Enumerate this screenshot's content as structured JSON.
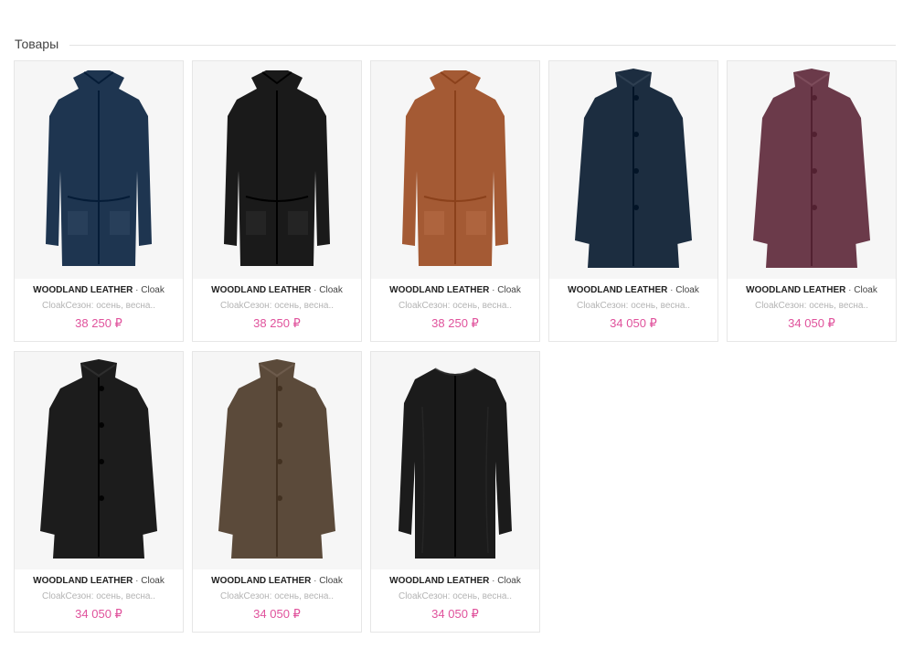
{
  "section": {
    "title": "Товары"
  },
  "products": [
    {
      "brand": "WOODLAND LEATHER",
      "separator": " · ",
      "category": "Cloak",
      "description": "CloakСезон: осень, весна..",
      "price": "38 250 ₽",
      "color": "#1e3550",
      "style": "parka"
    },
    {
      "brand": "WOODLAND LEATHER",
      "separator": " · ",
      "category": "Cloak",
      "description": "CloakСезон: осень, весна..",
      "price": "38 250 ₽",
      "color": "#1a1a1a",
      "style": "parka"
    },
    {
      "brand": "WOODLAND LEATHER",
      "separator": " · ",
      "category": "Cloak",
      "description": "CloakСезон: осень, весна..",
      "price": "38 250 ₽",
      "color": "#a45a34",
      "style": "parka"
    },
    {
      "brand": "WOODLAND LEATHER",
      "separator": " · ",
      "category": "Cloak",
      "description": "CloakСезон: осень, весна..",
      "price": "34 050 ₽",
      "color": "#1c2d40",
      "style": "aline"
    },
    {
      "brand": "WOODLAND LEATHER",
      "separator": " · ",
      "category": "Cloak",
      "description": "CloakСезон: осень, весна..",
      "price": "34 050 ₽",
      "color": "#6b3a4a",
      "style": "aline"
    },
    {
      "brand": "WOODLAND LEATHER",
      "separator": " · ",
      "category": "Cloak",
      "description": "CloakСезон: осень, весна..",
      "price": "34 050 ₽",
      "color": "#1c1c1c",
      "style": "aline"
    },
    {
      "brand": "WOODLAND LEATHER",
      "separator": " · ",
      "category": "Cloak",
      "description": "CloakСезон: осень, весна..",
      "price": "34 050 ₽",
      "color": "#5b4a3a",
      "style": "aline"
    },
    {
      "brand": "WOODLAND LEATHER",
      "separator": " · ",
      "category": "Cloak",
      "description": "CloakСезон: осень, весна..",
      "price": "34 050 ₽",
      "color": "#1b1b1b",
      "style": "round"
    }
  ]
}
